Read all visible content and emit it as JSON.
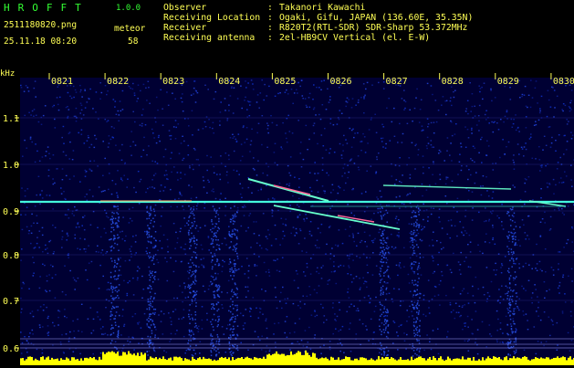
{
  "header": {
    "app_title": "HROFFT",
    "app_version": "1.0.0",
    "file_name": "2511180820.png",
    "meteor_label": "meteor",
    "timestamp": "25.11.18 08:20",
    "meteor_count": "58"
  },
  "info": [
    {
      "key": "Observer",
      "colon": ":",
      "value": "Takanori Kawachi"
    },
    {
      "key": "Receiving Location",
      "colon": ":",
      "value": "Ogaki, Gifu, JAPAN (136.60E, 35.35N)"
    },
    {
      "key": "Receiver",
      "colon": ":",
      "value": "R820T2(RTL-SDR) SDR-Sharp 53.372MHz"
    },
    {
      "key": "Receiving antenna",
      "colon": ":",
      "value": "2el-HB9CV Vertical (el. E-W)"
    }
  ],
  "spectrogram": {
    "y_unit": "kHz",
    "time_labels": [
      "0821",
      "0822",
      "0823",
      "0824",
      "0825",
      "0826",
      "0827",
      "0828",
      "0829",
      "0830"
    ],
    "freq_labels": [
      "1.1",
      "1.0",
      "0.9",
      "0.8",
      "0.7",
      "0.6"
    ],
    "colors": {
      "background": "#000033",
      "grid": "#3333aa",
      "axis_text": "#ffff55",
      "carrier": "#44ffdd",
      "noise": "#1133cc",
      "bottom_band": "#ffff00"
    }
  }
}
